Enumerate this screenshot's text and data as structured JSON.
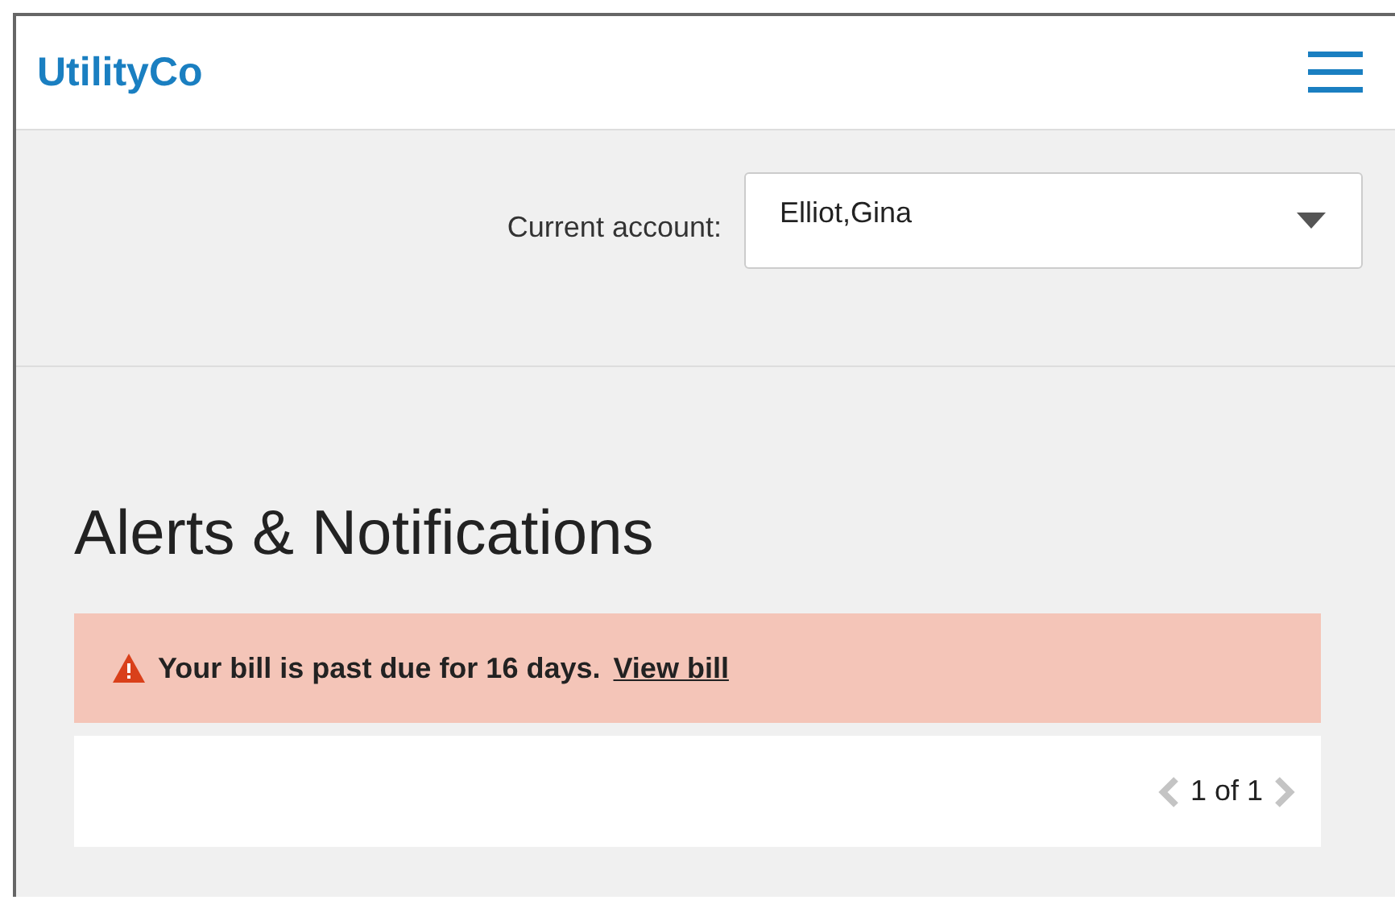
{
  "header": {
    "logo": "UtilityCo"
  },
  "account": {
    "label": "Current account:",
    "value": "Elliot,Gina"
  },
  "heading": "Alerts & Notifications",
  "alerts": [
    {
      "kind": "warning",
      "message": "Your bill is past due for 16 days.",
      "link": "View bill"
    }
  ],
  "pager": {
    "text": "1 of 1",
    "prev_disabled": true,
    "next_disabled": true
  }
}
